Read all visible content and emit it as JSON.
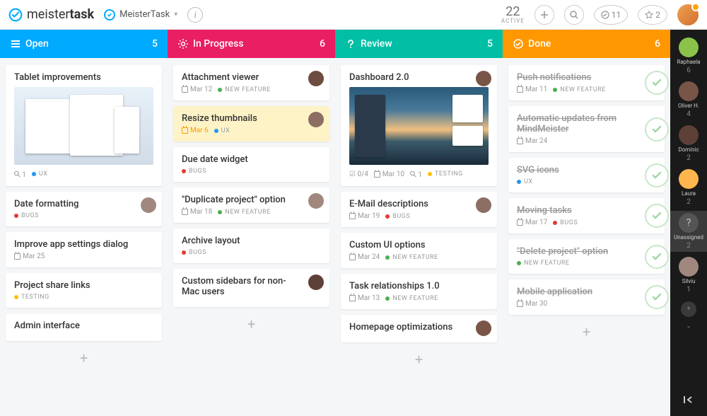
{
  "brand": {
    "prefix": "meister",
    "suffix": "task"
  },
  "project": {
    "name": "MeisterTask"
  },
  "top": {
    "active_count": "22",
    "active_label": "ACTIVE",
    "done_count": "11",
    "star_count": "2"
  },
  "columns": [
    {
      "title": "Open",
      "count": "5",
      "color": "#00aaff",
      "icon": "menu"
    },
    {
      "title": "In Progress",
      "count": "6",
      "color": "#e91e63",
      "icon": "gear"
    },
    {
      "title": "Review",
      "count": "5",
      "color": "#00bfa5",
      "icon": "question"
    },
    {
      "title": "Done",
      "count": "6",
      "color": "#ff9800",
      "icon": "check"
    }
  ],
  "cards": {
    "open": [
      {
        "title": "Tablet improvements",
        "image": "tablet",
        "attach": "1",
        "tags": [
          {
            "c": "blue",
            "t": "UX"
          }
        ]
      },
      {
        "title": "Date formatting",
        "tags": [
          {
            "c": "red",
            "t": "BUGS"
          }
        ],
        "avatar": "a3"
      },
      {
        "title": "Improve app settings dialog",
        "date": "Mar 25"
      },
      {
        "title": "Project share links",
        "tags": [
          {
            "c": "yellow",
            "t": "TESTING"
          }
        ]
      },
      {
        "title": "Admin interface"
      }
    ],
    "progress": [
      {
        "title": "Attachment viewer",
        "date": "Mar 12",
        "tags": [
          {
            "c": "green",
            "t": "NEW FEATURE"
          }
        ],
        "avatar": "a1"
      },
      {
        "title": "Resize thumbnails",
        "date": "Mar 6",
        "dateColor": "orange",
        "tags": [
          {
            "c": "blue",
            "t": "UX"
          }
        ],
        "avatar": "a2",
        "hl": true
      },
      {
        "title": "Due date widget",
        "tags": [
          {
            "c": "red",
            "t": "BUGS"
          }
        ]
      },
      {
        "title": "\"Duplicate project\" option",
        "date": "Mar 18",
        "tags": [
          {
            "c": "green",
            "t": "NEW FEATURE"
          }
        ],
        "avatar": "a3"
      },
      {
        "title": "Archive layout",
        "tags": [
          {
            "c": "red",
            "t": "BUGS"
          }
        ]
      },
      {
        "title": "Custom sidebars for non-Mac users",
        "avatar": "a4"
      }
    ],
    "review": [
      {
        "title": "Dashboard 2.0",
        "image": "dash",
        "checklist": "0/4",
        "date": "Mar 10",
        "attach": "1",
        "tags": [
          {
            "c": "yellow",
            "t": "TESTING"
          }
        ],
        "avatar": "a5"
      },
      {
        "title": "E-Mail descriptions",
        "date": "Mar 19",
        "tags": [
          {
            "c": "red",
            "t": "BUGS"
          }
        ],
        "avatar": "a2"
      },
      {
        "title": "Custom UI options",
        "date": "Mar 24",
        "tags": [
          {
            "c": "green",
            "t": "NEW FEATURE"
          }
        ]
      },
      {
        "title": "Task relationships 1.0",
        "date": "Mar 13",
        "tags": [
          {
            "c": "green",
            "t": "NEW FEATURE"
          }
        ]
      },
      {
        "title": "Homepage optimizations",
        "avatar": "a5"
      }
    ],
    "done": [
      {
        "title": "Push notifications",
        "date": "Mar 11",
        "tags": [
          {
            "c": "green",
            "t": "NEW FEATURE"
          }
        ]
      },
      {
        "title": "Automatic updates from MindMeister",
        "date": "Mar 24"
      },
      {
        "title": "SVG icons",
        "tags": [
          {
            "c": "blue",
            "t": "UX"
          }
        ]
      },
      {
        "title": "Moving tasks",
        "date": "Mar 17",
        "tags": [
          {
            "c": "red",
            "t": "BUGS"
          }
        ]
      },
      {
        "title": "\"Delete project\" option",
        "tags": [
          {
            "c": "green",
            "t": "NEW FEATURE"
          }
        ]
      },
      {
        "title": "Mobile application",
        "date": "Mar 30"
      }
    ]
  },
  "sidebar": [
    {
      "name": "Raphaela",
      "count": "6",
      "color": "#8bc34a"
    },
    {
      "name": "Oliver H.",
      "count": "4",
      "color": "#795548"
    },
    {
      "name": "Dominic",
      "count": "2",
      "color": "#5d4037"
    },
    {
      "name": "Laura",
      "count": "2",
      "color": "#ffb74d"
    },
    {
      "name": "Unassigned",
      "count": "2",
      "color": "#555",
      "q": true,
      "sel": true
    },
    {
      "name": "Silviu",
      "count": "1",
      "color": "#a1887f"
    }
  ],
  "avatar_colors": {
    "a1": "#6d4c41",
    "a2": "#8d6e63",
    "a3": "#a1887f",
    "a4": "#5d4037",
    "a5": "#795548"
  }
}
